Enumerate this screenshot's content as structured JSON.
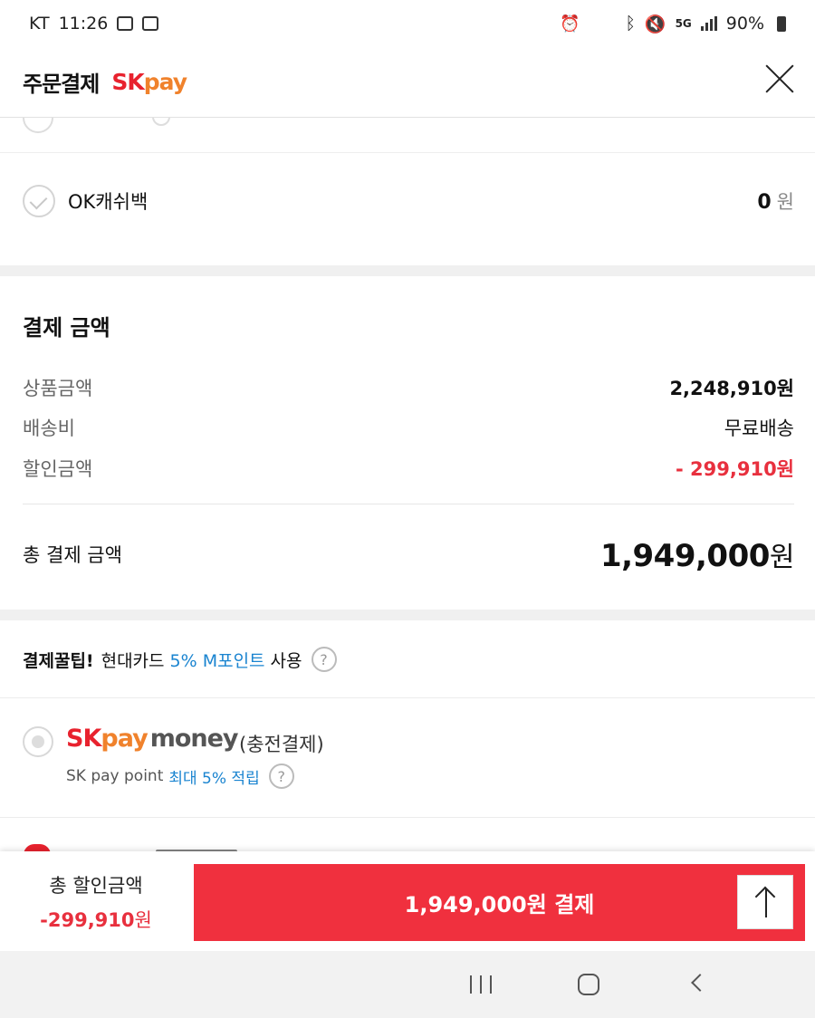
{
  "status_bar": {
    "carrier": "KT",
    "time": "11:26",
    "network": "5G",
    "battery": "90%"
  },
  "header": {
    "title": "주문결제",
    "logo_sk": "SK",
    "logo_pay": "pay"
  },
  "ok_cashbag": {
    "label": "OK캐쉬백",
    "value": "0",
    "unit": "원"
  },
  "payment_amount": {
    "title": "결제 금액",
    "rows": [
      {
        "label": "상품금액",
        "value": "2,248,910원"
      },
      {
        "label": "배송비",
        "value": "무료배송"
      },
      {
        "label": "할인금액",
        "value": "- 299,910원"
      }
    ],
    "total_label": "총 결제 금액",
    "total_value": "1,949,000",
    "total_unit": "원"
  },
  "tip": {
    "bold": "결제꿀팁!",
    "text1": "현대카드",
    "highlight": "5% M포인트",
    "text2": "사용",
    "help": "?"
  },
  "sk_pay_money": {
    "logo_sk": "SK",
    "logo_pay": "pay",
    "logo_money": "money",
    "charge_label": "(충전결제)",
    "point_text": "SK pay point",
    "point_highlight": "최대 5% 적립",
    "help": "?"
  },
  "bottom_bar": {
    "discount_label": "총 할인금액",
    "discount_value": "-299,910",
    "discount_unit": "원",
    "pay_button": "1,949,000원 결제"
  },
  "colors": {
    "accent_red": "#f0303e",
    "link_blue": "#1a84d0",
    "sk_red": "#e8222e",
    "pay_orange": "#f0822c"
  }
}
